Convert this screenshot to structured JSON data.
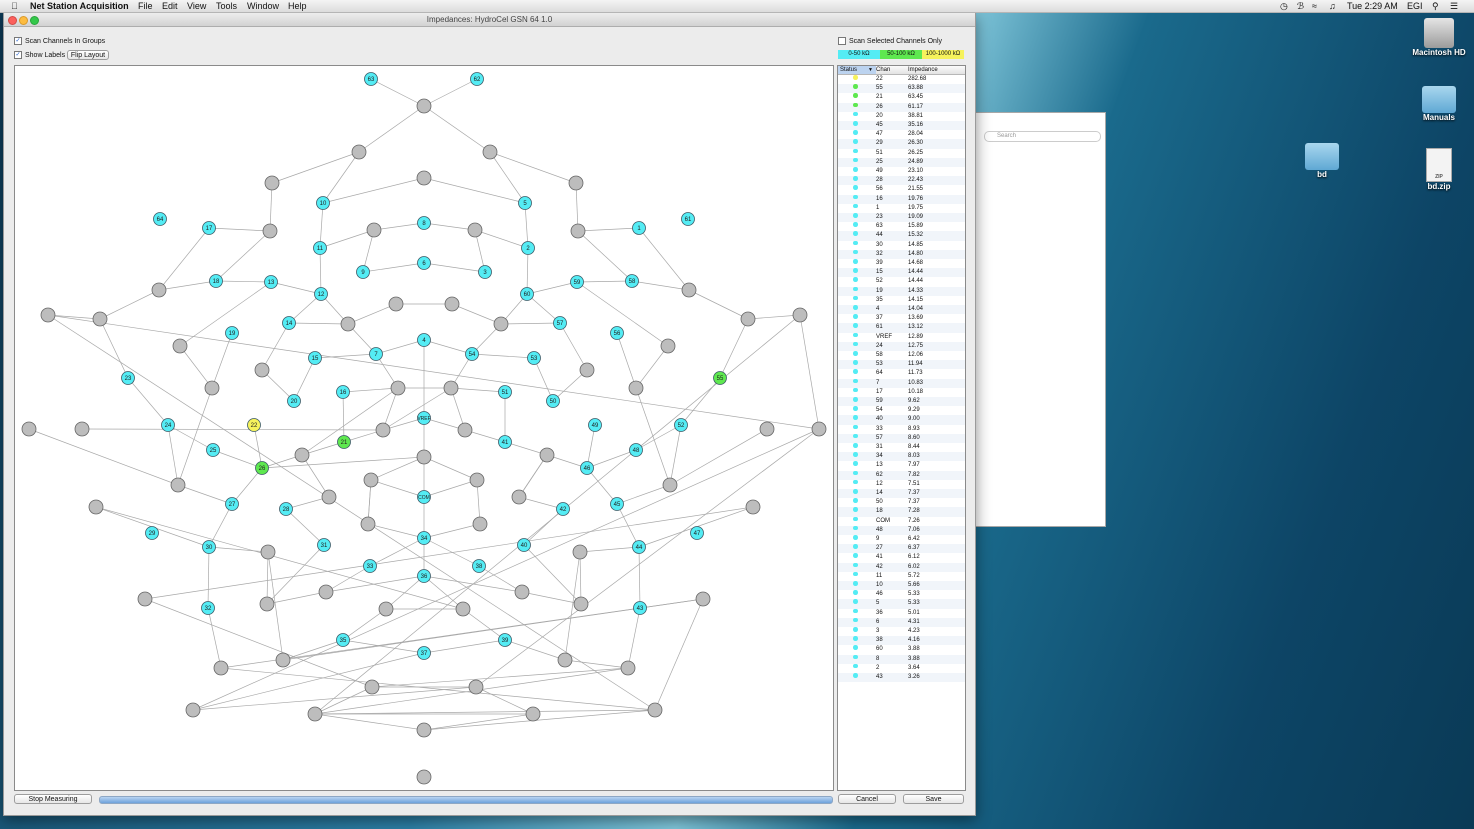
{
  "menubar": {
    "app_name": "Net Station Acquisition",
    "menus": [
      "File",
      "Edit",
      "View",
      "Tools",
      "Window",
      "Help"
    ],
    "clock": "Tue 2:29 AM",
    "user": "EGI"
  },
  "window": {
    "title": "Impedances: HydroCel GSN 64 1.0"
  },
  "options": {
    "scan_groups": "Scan Channels In Groups",
    "show_labels": "Show Labels",
    "flip_layout": "Flip Layout",
    "scan_selected": "Scan Selected Channels Only"
  },
  "legend": [
    {
      "label": "0-50 kΩ",
      "color": "#54ecf4"
    },
    {
      "label": "50-100 kΩ",
      "color": "#5ee84f"
    },
    {
      "label": "100-1000 kΩ",
      "color": "#f6f25c"
    }
  ],
  "colors": {
    "cyan": "#54ecf4",
    "green": "#5ee84f",
    "yellow": "#f6f25c",
    "unlabeled": "#bdbdbd"
  },
  "table": {
    "headers": [
      "Status",
      "Chan",
      "Impedance"
    ],
    "rows": [
      [
        "yellow",
        "22",
        "282.68"
      ],
      [
        "green",
        "55",
        "63.88"
      ],
      [
        "green",
        "21",
        "63.45"
      ],
      [
        "green",
        "26",
        "61.17"
      ],
      [
        "cyan",
        "20",
        "38.81"
      ],
      [
        "cyan",
        "45",
        "35.16"
      ],
      [
        "cyan",
        "47",
        "28.04"
      ],
      [
        "cyan",
        "29",
        "26.30"
      ],
      [
        "cyan",
        "51",
        "26.25"
      ],
      [
        "cyan",
        "25",
        "24.89"
      ],
      [
        "cyan",
        "49",
        "23.10"
      ],
      [
        "cyan",
        "28",
        "22.43"
      ],
      [
        "cyan",
        "56",
        "21.55"
      ],
      [
        "cyan",
        "16",
        "19.76"
      ],
      [
        "cyan",
        "1",
        "19.75"
      ],
      [
        "cyan",
        "23",
        "19.09"
      ],
      [
        "cyan",
        "63",
        "15.89"
      ],
      [
        "cyan",
        "44",
        "15.32"
      ],
      [
        "cyan",
        "30",
        "14.85"
      ],
      [
        "cyan",
        "32",
        "14.80"
      ],
      [
        "cyan",
        "39",
        "14.68"
      ],
      [
        "cyan",
        "15",
        "14.44"
      ],
      [
        "cyan",
        "52",
        "14.44"
      ],
      [
        "cyan",
        "19",
        "14.33"
      ],
      [
        "cyan",
        "35",
        "14.15"
      ],
      [
        "cyan",
        "4",
        "14.04"
      ],
      [
        "cyan",
        "37",
        "13.69"
      ],
      [
        "cyan",
        "61",
        "13.12"
      ],
      [
        "cyan",
        "VREF",
        "12.89"
      ],
      [
        "cyan",
        "24",
        "12.75"
      ],
      [
        "cyan",
        "58",
        "12.06"
      ],
      [
        "cyan",
        "53",
        "11.94"
      ],
      [
        "cyan",
        "64",
        "11.73"
      ],
      [
        "cyan",
        "7",
        "10.83"
      ],
      [
        "cyan",
        "17",
        "10.18"
      ],
      [
        "cyan",
        "59",
        "9.62"
      ],
      [
        "cyan",
        "54",
        "9.29"
      ],
      [
        "cyan",
        "40",
        "9.00"
      ],
      [
        "cyan",
        "33",
        "8.93"
      ],
      [
        "cyan",
        "57",
        "8.60"
      ],
      [
        "cyan",
        "31",
        "8.44"
      ],
      [
        "cyan",
        "34",
        "8.03"
      ],
      [
        "cyan",
        "13",
        "7.97"
      ],
      [
        "cyan",
        "62",
        "7.82"
      ],
      [
        "cyan",
        "12",
        "7.51"
      ],
      [
        "cyan",
        "14",
        "7.37"
      ],
      [
        "cyan",
        "50",
        "7.37"
      ],
      [
        "cyan",
        "18",
        "7.28"
      ],
      [
        "cyan",
        "COM",
        "7.26"
      ],
      [
        "cyan",
        "48",
        "7.06"
      ],
      [
        "cyan",
        "9",
        "6.42"
      ],
      [
        "cyan",
        "27",
        "6.37"
      ],
      [
        "cyan",
        "41",
        "6.12"
      ],
      [
        "cyan",
        "42",
        "6.02"
      ],
      [
        "cyan",
        "11",
        "5.72"
      ],
      [
        "cyan",
        "10",
        "5.66"
      ],
      [
        "cyan",
        "46",
        "5.33"
      ],
      [
        "cyan",
        "5",
        "5.33"
      ],
      [
        "cyan",
        "36",
        "5.01"
      ],
      [
        "cyan",
        "6",
        "4.31"
      ],
      [
        "cyan",
        "3",
        "4.23"
      ],
      [
        "cyan",
        "38",
        "4.16"
      ],
      [
        "cyan",
        "60",
        "3.88"
      ],
      [
        "cyan",
        "8",
        "3.88"
      ],
      [
        "cyan",
        "2",
        "3.64"
      ],
      [
        "cyan",
        "43",
        "3.26"
      ]
    ]
  },
  "buttons": {
    "stop": "Stop Measuring",
    "cancel": "Cancel",
    "save": "Save"
  },
  "desktop": {
    "icons": [
      "Macintosh HD",
      "Manuals",
      "bd",
      "bd.zip"
    ],
    "search_placeholder": "Search",
    "zip_badge": "ZIP"
  }
}
